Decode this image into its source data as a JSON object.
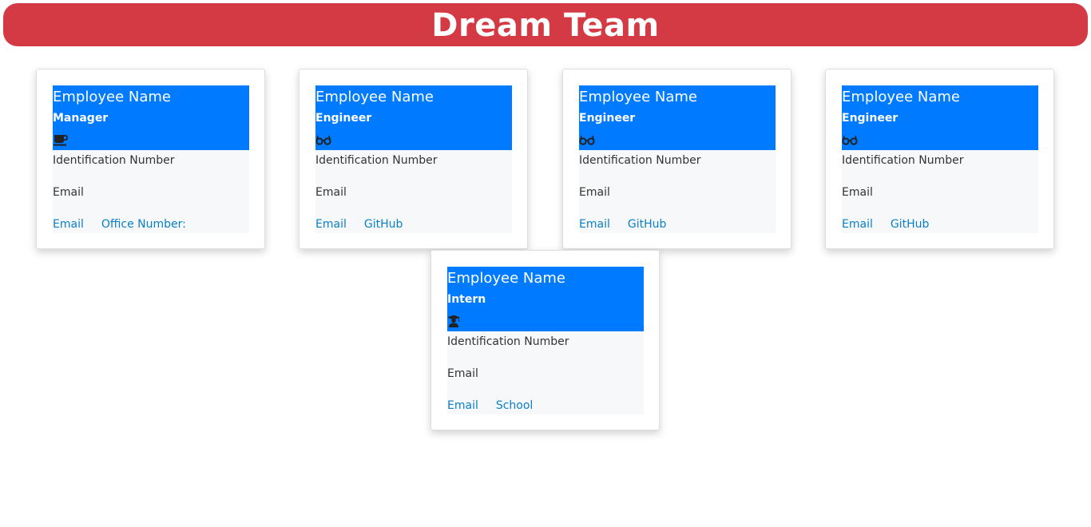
{
  "header": {
    "title": "Dream Team"
  },
  "cards": [
    {
      "name": "Employee Name",
      "role": "Manager",
      "icon": "coffee-icon",
      "id_label": "Identification Number",
      "email_label": "Email",
      "link1": "Email",
      "link2": "Office Number:"
    },
    {
      "name": "Employee Name",
      "role": "Engineer",
      "icon": "glasses-icon",
      "id_label": "Identification Number",
      "email_label": "Email",
      "link1": "Email",
      "link2": "GitHub"
    },
    {
      "name": "Employee Name",
      "role": "Engineer",
      "icon": "glasses-icon",
      "id_label": "Identification Number",
      "email_label": "Email",
      "link1": "Email",
      "link2": "GitHub"
    },
    {
      "name": "Employee Name",
      "role": "Engineer",
      "icon": "glasses-icon",
      "id_label": "Identification Number",
      "email_label": "Email",
      "link1": "Email",
      "link2": "GitHub"
    },
    {
      "name": "Employee Name",
      "role": "Intern",
      "icon": "graduate-icon",
      "id_label": "Identification Number",
      "email_label": "Email",
      "link1": "Email",
      "link2": "School"
    }
  ],
  "colors": {
    "banner": "#d33a43",
    "card_header": "#007bff",
    "link": "#0a7fc7"
  }
}
